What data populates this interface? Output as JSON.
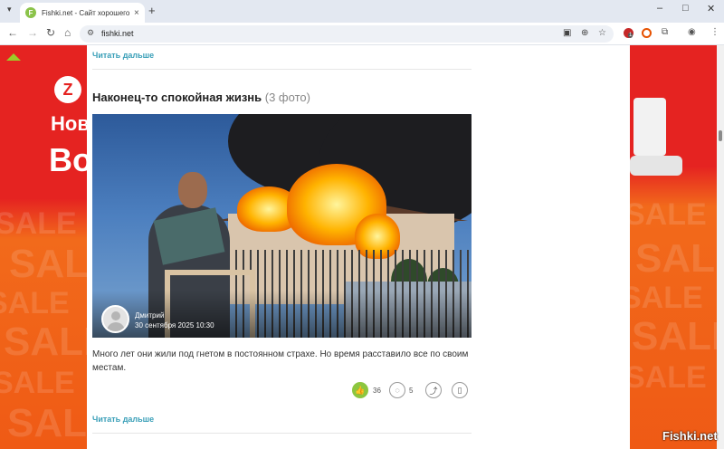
{
  "browser": {
    "tab_title": "Fishki.net - Сайт хорошего настроения",
    "tab_favicon": "F",
    "new_tab": "+",
    "close_tab": "×",
    "address": "fishki.net",
    "window_controls": {
      "minimize": "–",
      "maximize": "□",
      "close": "✕"
    },
    "extension_badge": "1"
  },
  "ad": {
    "logo": "Z",
    "line1": "Нов",
    "line2": "Во",
    "pattern_text": "SALE"
  },
  "page": {
    "read_more_top": "Читать дальше",
    "post": {
      "title": "Наконец-то спокойная жизнь",
      "photo_count": "(3 фото)",
      "author": "Дмитрий",
      "date": "30 сентября 2025 10:30",
      "excerpt": "Много лет они жили под гнетом в постоянном страхе. Но время расставило все по своим местам.",
      "likes": "36",
      "comments": "5"
    },
    "read_more_bottom": "Читать дальше"
  },
  "watermark": "Fishki.net",
  "colors": {
    "accent_link": "#3a9fb8",
    "like_green": "#8cc63f",
    "ad_red": "#e52321",
    "ad_orange": "#f26a1b"
  },
  "icons": {
    "back": "back-arrow-icon",
    "forward": "forward-arrow-icon",
    "reload": "reload-icon",
    "home": "home-icon",
    "like": "thumbs-up-icon",
    "comment": "comment-bubble-icon",
    "share": "share-icon",
    "bookmark": "bookmark-icon"
  }
}
